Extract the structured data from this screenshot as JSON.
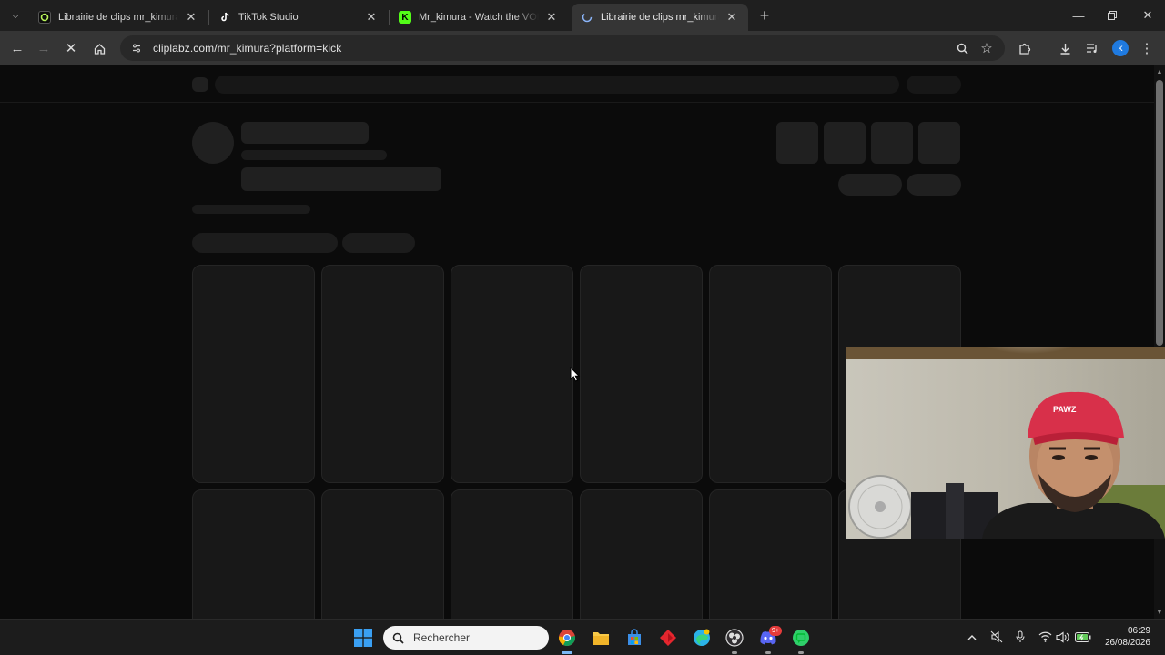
{
  "browser": {
    "tabs": [
      {
        "title": "Librairie de clips mr_kimura | Clip",
        "active": false,
        "favicon": "cliplabz-icon"
      },
      {
        "title": "TikTok Studio",
        "active": false,
        "favicon": "tiktok-icon"
      },
      {
        "title": "Mr_kimura - Watch the VOD on Kick",
        "active": false,
        "favicon": "kick-icon"
      },
      {
        "title": "Librairie de clips mr_kimura | Clip",
        "active": true,
        "favicon": "loading-icon"
      }
    ],
    "url": "cliplabz.com/mr_kimura?platform=kick",
    "profile_initial": "k",
    "loading": true
  },
  "page": {
    "state": "skeleton-loading",
    "grid_columns": 6,
    "visible_rows": 2
  },
  "taskbar": {
    "search_placeholder": "Rechercher",
    "discord_badge": "9+",
    "time": "06:29",
    "date": "26/08/2026"
  },
  "colors": {
    "page_bg": "#0b0b0b",
    "skeleton": "#202020",
    "card": "#181818",
    "kick_green": "#53fc18",
    "profile_blue": "#1f7ae0",
    "cap_red": "#d8304a"
  }
}
